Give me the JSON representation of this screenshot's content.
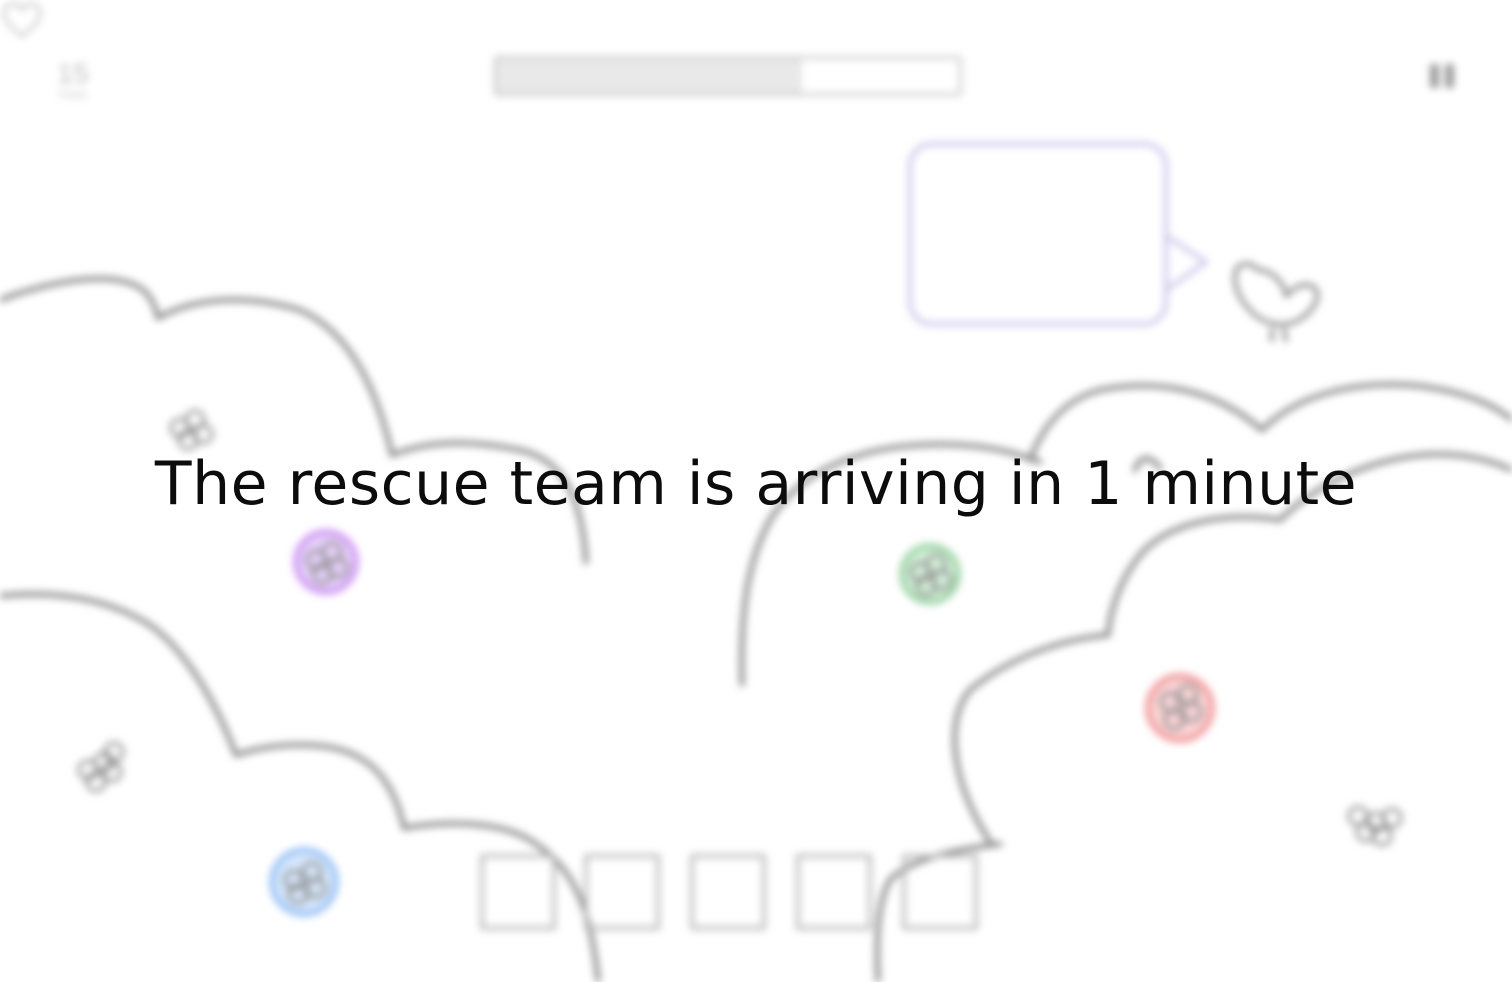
{
  "hud": {
    "score_value": "15",
    "score_label": "Points",
    "rescue_progress": 0.66,
    "lives_icon": "heart-outline",
    "pause_icon": "pause"
  },
  "speech_bubble": {
    "text": ""
  },
  "inventory": {
    "slot_count": 5
  },
  "message": {
    "text": "The rescue team is arriving in 1 minute"
  },
  "colors": {
    "background": "#ffffff",
    "bubble_border": "#c9c3e8",
    "flower_purple": "#c88cf0",
    "flower_green": "#8fd09a",
    "flower_red": "#f08f8f",
    "flower_blue": "#8cbcf5",
    "outline": "#8a8a8a"
  }
}
